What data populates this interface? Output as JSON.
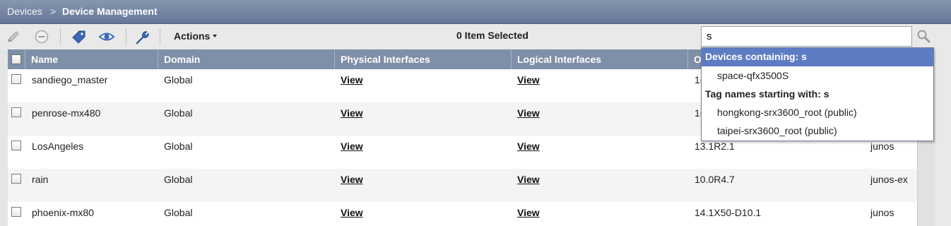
{
  "breadcrumb": {
    "root": "Devices",
    "separator": ">",
    "current": "Device Management"
  },
  "toolbar": {
    "icons": [
      "pencil-icon",
      "minus-circle-icon",
      "tag-icon",
      "eye-icon",
      "wrench-icon"
    ],
    "actions_label": "Actions",
    "selected_text": "0 Item Selected"
  },
  "search": {
    "value": "s"
  },
  "grid": {
    "columns": [
      "Name",
      "Domain",
      "Physical Interfaces",
      "Logical Interfaces",
      "O"
    ],
    "rows": [
      {
        "name": "sandiego_master",
        "domain": "Global",
        "physical": "View",
        "logical": "View",
        "os": "1(",
        "platform": ""
      },
      {
        "name": "penrose-mx480",
        "domain": "Global",
        "physical": "View",
        "logical": "View",
        "os": "1(",
        "platform": ""
      },
      {
        "name": "LosAngeles",
        "domain": "Global",
        "physical": "View",
        "logical": "View",
        "os": "13.1R2.1",
        "platform": "junos"
      },
      {
        "name": "rain",
        "domain": "Global",
        "physical": "View",
        "logical": "View",
        "os": "10.0R4.7",
        "platform": "junos-ex"
      },
      {
        "name": "phoenix-mx80",
        "domain": "Global",
        "physical": "View",
        "logical": "View",
        "os": "14.1X50-D10.1",
        "platform": "junos"
      }
    ]
  },
  "dropdown": {
    "devices_header": "Devices containing: s",
    "devices": [
      "space-qfx3500S"
    ],
    "tags_header": "Tag names starting with: s",
    "tags": [
      "hongkong-srx3600_root (public)",
      "taipei-srx3600_root (public)"
    ]
  },
  "colors": {
    "header_bar": "#7f8fa8",
    "highlight": "#5e7cc3",
    "breadcrumb_bar": "#6f819f"
  }
}
